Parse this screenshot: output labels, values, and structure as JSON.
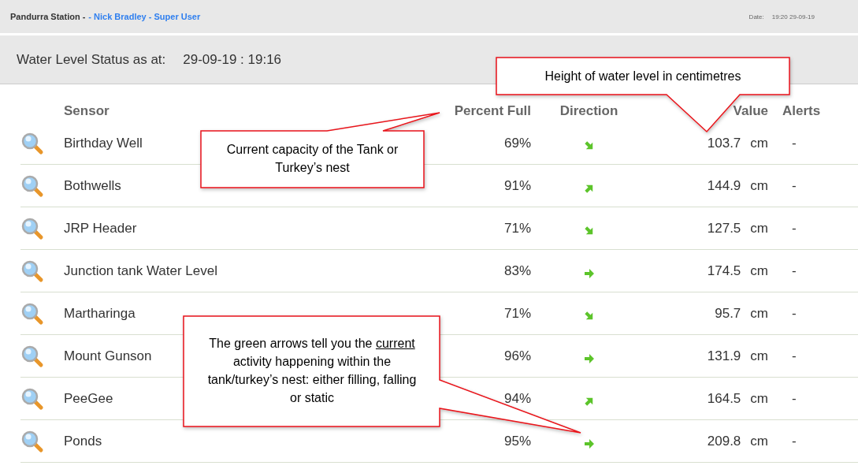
{
  "top_bar": {
    "station": "Pandurra Station -",
    "user": "- Nick Bradley - Super User",
    "date_label": "Date:",
    "date_value": "19:20 29-09-19"
  },
  "status_bar": {
    "label": "Water Level Status as at:",
    "timestamp": "29-09-19 : 19:16"
  },
  "table": {
    "columns": [
      "Sensor",
      "Percent Full",
      "Direction",
      "Value",
      "Alerts"
    ],
    "rows": [
      {
        "sensor": "Birthday Well",
        "percent": "69%",
        "kind": "falling",
        "value": "103.7",
        "unit": "cm",
        "alerts": "-"
      },
      {
        "sensor": "Bothwells",
        "percent": "91%",
        "kind": "rising",
        "value": "144.9",
        "unit": "cm",
        "alerts": "-"
      },
      {
        "sensor": "JRP Header",
        "percent": "71%",
        "kind": "falling",
        "value": "127.5",
        "unit": "cm",
        "alerts": "-"
      },
      {
        "sensor": "Junction tank Water Level",
        "percent": "83%",
        "kind": "steady",
        "value": "174.5",
        "unit": "cm",
        "alerts": "-"
      },
      {
        "sensor": "Martharinga",
        "percent": "71%",
        "kind": "falling",
        "value": "95.7",
        "unit": "cm",
        "alerts": "-"
      },
      {
        "sensor": "Mount Gunson",
        "percent": "96%",
        "kind": "steady",
        "value": "131.9",
        "unit": "cm",
        "alerts": "-"
      },
      {
        "sensor": "PeeGee",
        "percent": "94%",
        "kind": "rising",
        "value": "164.5",
        "unit": "cm",
        "alerts": "-"
      },
      {
        "sensor": "Ponds",
        "percent": "95%",
        "kind": "steady",
        "value": "209.8",
        "unit": "cm",
        "alerts": "-"
      }
    ]
  },
  "callouts": [
    {
      "kind": "value",
      "text": "Height of water level in centimetres"
    },
    {
      "kind": "percent",
      "text": "Current capacity of the Tank or Turkey’s nest"
    },
    {
      "kind": "direction",
      "text_before": "The green arrows tell you the",
      "underlined": "current",
      "text_after": "activity happening within the tank/turkey’s nest: either filling, falling or static"
    }
  ]
}
